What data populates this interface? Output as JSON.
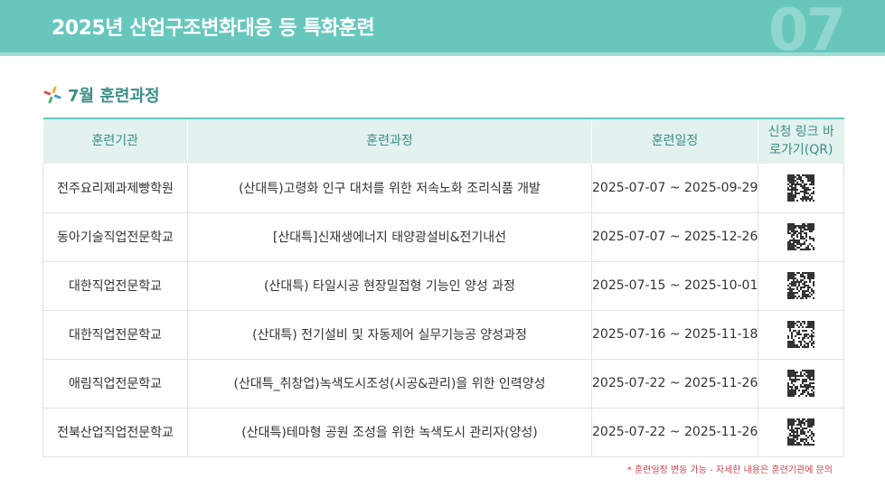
{
  "header": {
    "title": "2025년 산업구조변화대응 등 특화훈련",
    "page_number": "07"
  },
  "section": {
    "title": "7월 훈련과정"
  },
  "table": {
    "headers": [
      "훈련기관",
      "훈련과정",
      "훈련일정",
      "신청 링크 바로가기(QR)"
    ],
    "rows": [
      {
        "institution": "전주요리제과제빵학원",
        "course": "(산대특)고령화 인구 대처를 위한 저속노화 조리식품 개발",
        "schedule": "2025-07-07 ~ 2025-09-29"
      },
      {
        "institution": "동아기술직업전문학교",
        "course": "[산대특]신재생에너지 태양광설비&전기내선",
        "schedule": "2025-07-07 ~ 2025-12-26"
      },
      {
        "institution": "대한직업전문학교",
        "course": "(산대특) 타일시공 현장밀접형 기능인 양성 과정",
        "schedule": "2025-07-15 ~ 2025-10-01"
      },
      {
        "institution": "대한직업전문학교",
        "course": "(산대특) 전기설비 및 자동제어 실무기능공 양성과정",
        "schedule": "2025-07-16 ~ 2025-11-18"
      },
      {
        "institution": "애림직업전문학교",
        "course": "(산대특_취창업)녹색도시조성(시공&관리)을 위한 인력양성",
        "schedule": "2025-07-22 ~ 2025-11-26"
      },
      {
        "institution": "전북산업직업전문학교",
        "course": "(산대특)테마형 공원 조성을 위한 녹색도시 관리자(양성)",
        "schedule": "2025-07-22 ~ 2025-11-26"
      }
    ]
  },
  "footnote": "* 훈련일정 변동 가능 - 자세한 내용은 훈련기관에 문의",
  "colors": {
    "accent": "#67c7bd",
    "accent_text": "#3a8f86",
    "header_bg": "#e3f1ef",
    "footnote": "#d0434f"
  }
}
